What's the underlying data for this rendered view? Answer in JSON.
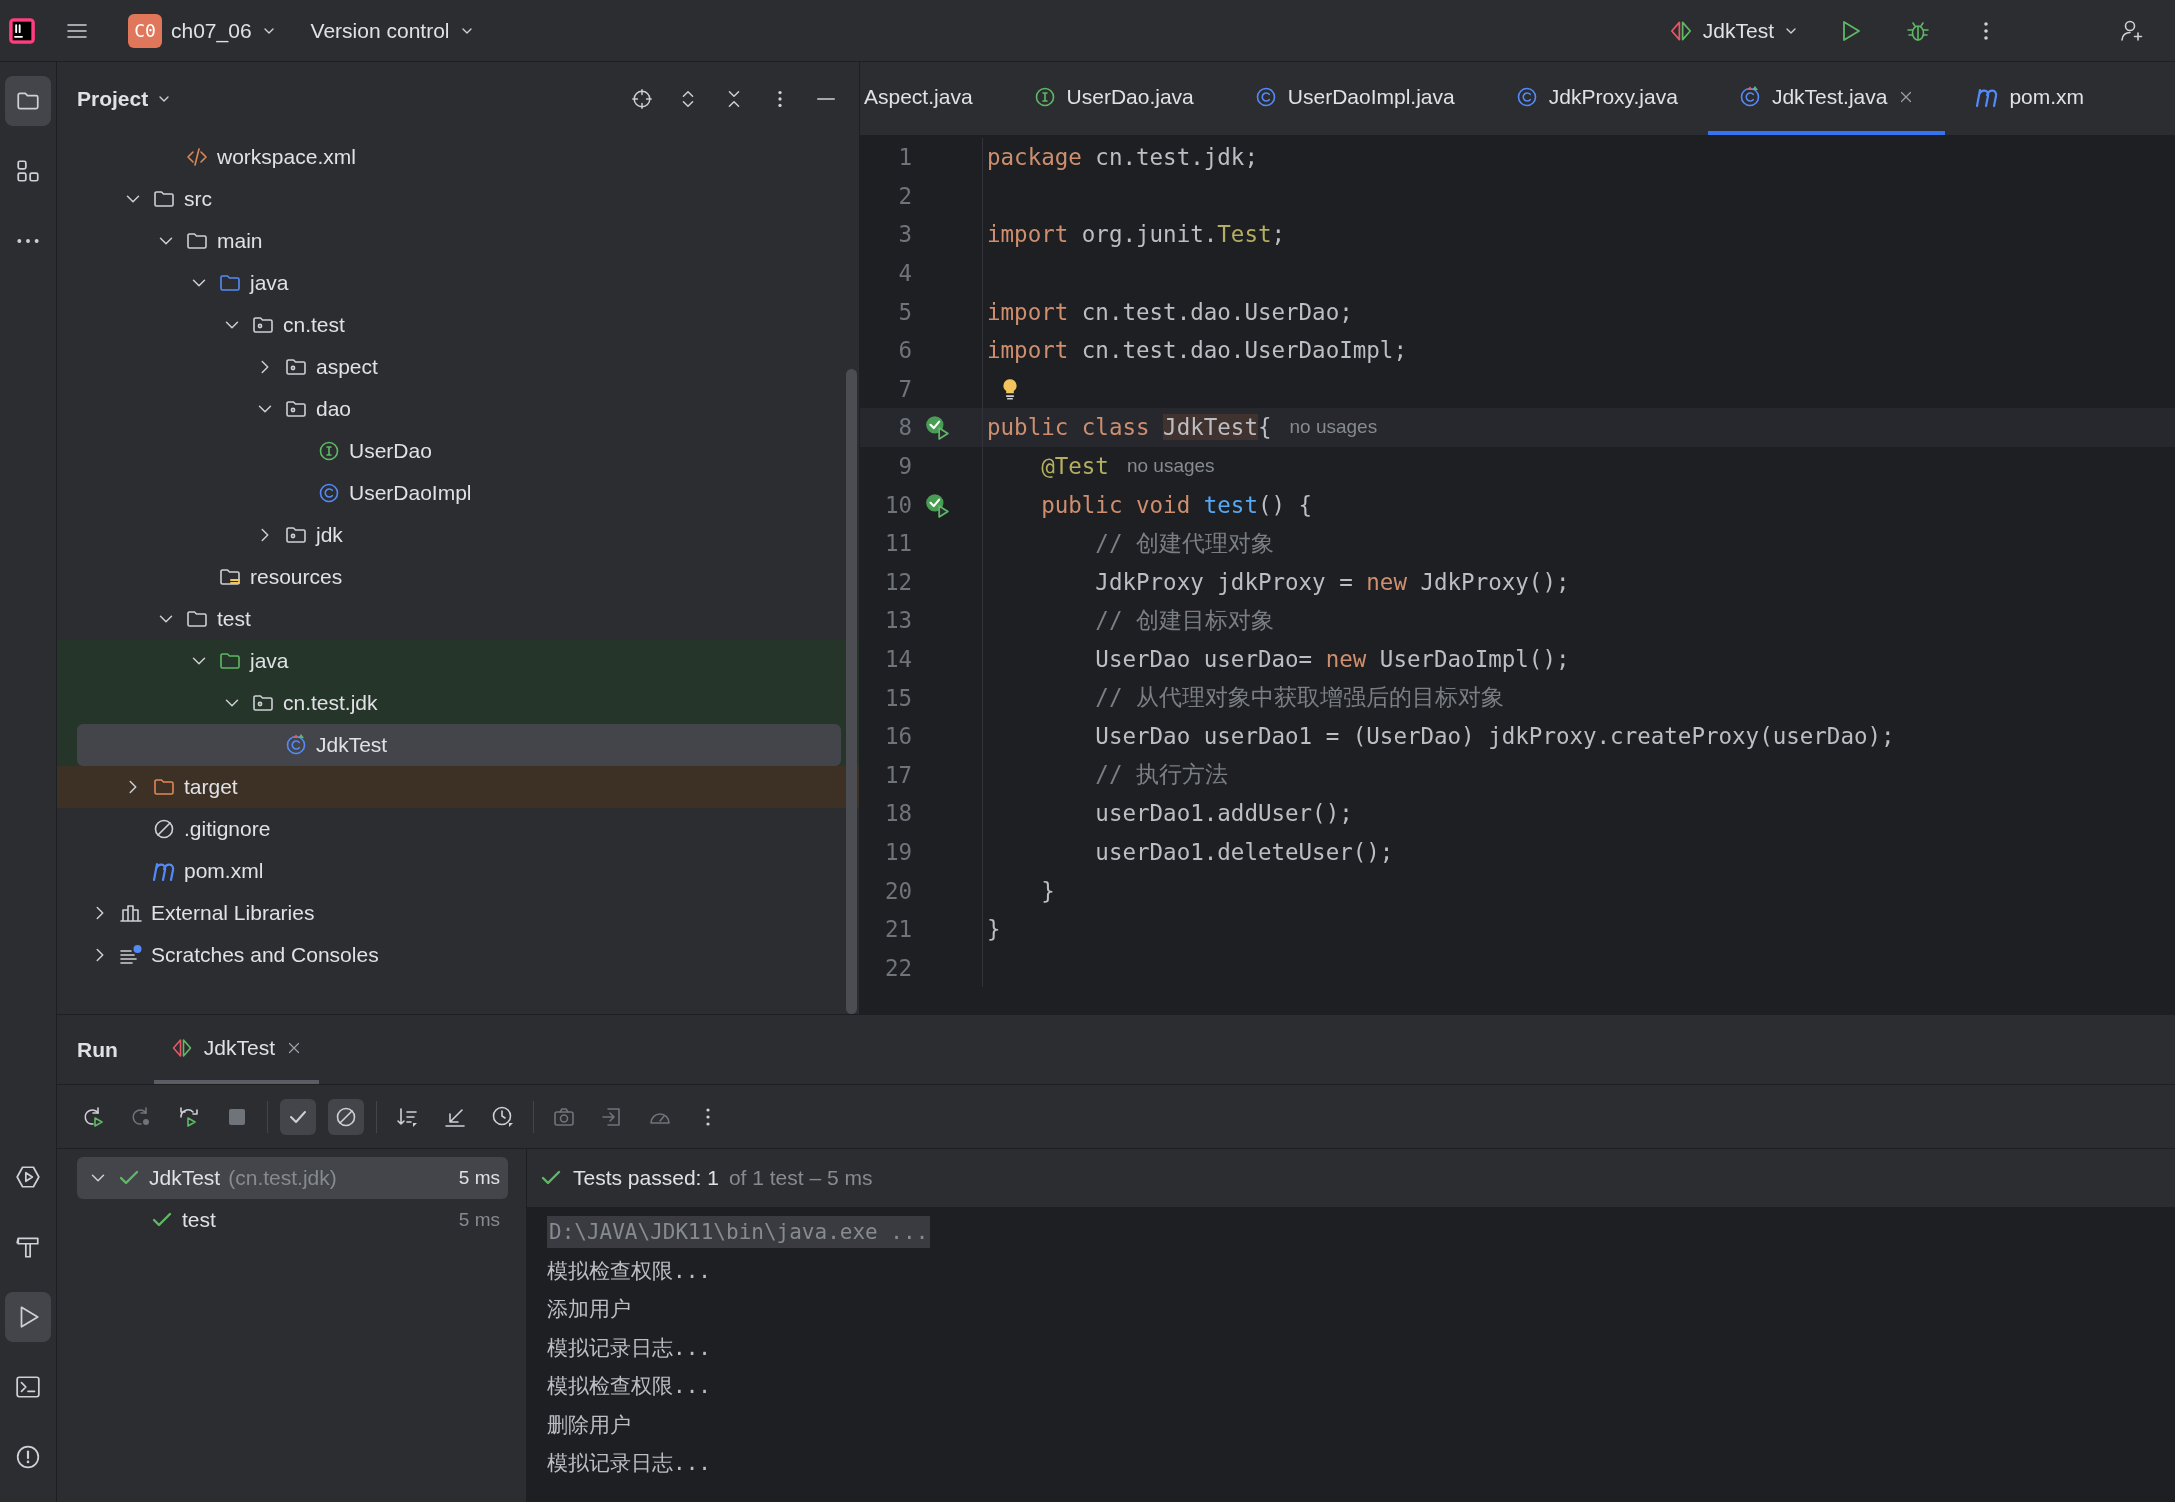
{
  "top_bar": {
    "project_badge": "C0",
    "project_name": "ch07_06",
    "vcs_menu": "Version control",
    "run_config": "JdkTest"
  },
  "left_toolbar": {
    "top": [
      {
        "kind": "project",
        "selected": true
      },
      {
        "kind": "structure",
        "selected": false
      },
      {
        "kind": "more",
        "selected": false
      }
    ],
    "bottom": [
      {
        "kind": "services",
        "selected": false
      },
      {
        "kind": "build",
        "selected": false
      },
      {
        "kind": "run",
        "selected": true
      },
      {
        "kind": "terminal",
        "selected": false
      },
      {
        "kind": "problems",
        "selected": false
      }
    ]
  },
  "project_panel": {
    "title": "Project",
    "tree": [
      {
        "kind": "clipped",
        "children": [
          {
            "label": "workspace.xml",
            "kind": "xml",
            "selected": false
          }
        ]
      },
      {
        "label": "src",
        "kind": "folder",
        "expanded": true,
        "selected": false,
        "children": [
          {
            "label": "main",
            "kind": "folder",
            "expanded": true,
            "selected": false,
            "children": [
              {
                "label": "java",
                "kind": "source-folder",
                "expanded": true,
                "selected": false,
                "children": [
                  {
                    "label": "cn.test",
                    "kind": "package",
                    "expanded": true,
                    "selected": false,
                    "children": [
                      {
                        "label": "aspect",
                        "kind": "package",
                        "expanded": false,
                        "selected": false
                      },
                      {
                        "label": "dao",
                        "kind": "package",
                        "expanded": true,
                        "selected": false,
                        "children": [
                          {
                            "label": "UserDao",
                            "kind": "interface",
                            "selected": false
                          },
                          {
                            "label": "UserDaoImpl",
                            "kind": "class",
                            "selected": false
                          }
                        ]
                      },
                      {
                        "label": "jdk",
                        "kind": "package",
                        "expanded": false,
                        "selected": false
                      }
                    ]
                  }
                ]
              },
              {
                "label": "resources",
                "kind": "resources",
                "selected": false
              }
            ]
          },
          {
            "label": "test",
            "kind": "folder",
            "expanded": true,
            "selected": false,
            "children": [
              {
                "label": "java",
                "kind": "test-folder",
                "expanded": true,
                "selected": false,
                "test_scope": true,
                "children": [
                  {
                    "label": "cn.test.jdk",
                    "kind": "package",
                    "expanded": true,
                    "selected": false,
                    "test_scope": true,
                    "children": [
                      {
                        "label": "JdkTest",
                        "kind": "test-class",
                        "selected": true,
                        "test_scope": true
                      }
                    ]
                  }
                ]
              }
            ]
          }
        ]
      },
      {
        "label": "target",
        "kind": "excluded-folder",
        "expanded": false,
        "selected": false,
        "excluded": true
      },
      {
        "label": ".gitignore",
        "kind": "ignore",
        "selected": false
      },
      {
        "label": "pom.xml",
        "kind": "maven",
        "selected": false
      }
    ],
    "roots": [
      {
        "label": "External Libraries",
        "kind": "libraries",
        "expanded": false,
        "selected": false
      },
      {
        "label": "Scratches and Consoles",
        "kind": "scratches",
        "expanded": false,
        "selected": false
      }
    ]
  },
  "editor": {
    "tabs": [
      {
        "label": "Aspect.java",
        "selected": false,
        "closable": false
      },
      {
        "label": "UserDao.java",
        "kind": "interface",
        "selected": false,
        "closable": false
      },
      {
        "label": "UserDaoImpl.java",
        "kind": "class",
        "selected": false,
        "closable": false
      },
      {
        "label": "JdkProxy.java",
        "kind": "class",
        "selected": false,
        "closable": false
      },
      {
        "label": "JdkTest.java",
        "kind": "test-class",
        "selected": true,
        "closable": true
      },
      {
        "label": "pom.xm",
        "kind": "maven",
        "selected": false,
        "closable": false
      }
    ],
    "lines": [
      {
        "number": "1",
        "tokens": [
          {
            "text": "package",
            "kind": "keyword"
          },
          {
            "text": " cn.test.jdk;",
            "kind": "plain"
          }
        ]
      },
      {
        "number": "2"
      },
      {
        "number": "3",
        "tokens": [
          {
            "text": "import",
            "kind": "keyword"
          },
          {
            "text": " org.junit.",
            "kind": "plain"
          },
          {
            "text": "Test",
            "kind": "annotation"
          },
          {
            "text": ";",
            "kind": "plain"
          }
        ]
      },
      {
        "number": "4"
      },
      {
        "number": "5",
        "tokens": [
          {
            "text": "import",
            "kind": "keyword"
          },
          {
            "text": " cn.test.dao.UserDao;",
            "kind": "plain"
          }
        ]
      },
      {
        "number": "6",
        "tokens": [
          {
            "text": "import",
            "kind": "keyword"
          },
          {
            "text": " cn.test.dao.UserDaoImpl;",
            "kind": "plain"
          }
        ]
      },
      {
        "number": "7",
        "lightbulb": true
      },
      {
        "number": "8",
        "current": true,
        "run_gutter": true,
        "tokens": [
          {
            "text": "public class ",
            "kind": "keyword"
          },
          {
            "text": "JdkTest",
            "kind": "usage"
          },
          {
            "text": "{",
            "kind": "plain"
          }
        ],
        "hint": "no usages"
      },
      {
        "number": "9",
        "tokens": [
          {
            "text": "    @Test",
            "kind": "annotation"
          }
        ],
        "hint": "no usages"
      },
      {
        "number": "10",
        "run_gutter": true,
        "tokens": [
          {
            "text": "    public void ",
            "kind": "keyword"
          },
          {
            "text": "test",
            "kind": "method"
          },
          {
            "text": "() {",
            "kind": "plain"
          }
        ]
      },
      {
        "number": "11",
        "tokens": [
          {
            "text": "        // 创建代理对象",
            "kind": "comment"
          }
        ]
      },
      {
        "number": "12",
        "tokens": [
          {
            "text": "        JdkProxy jdkProxy = ",
            "kind": "plain"
          },
          {
            "text": "new",
            "kind": "keyword"
          },
          {
            "text": " JdkProxy();",
            "kind": "plain"
          }
        ]
      },
      {
        "number": "13",
        "tokens": [
          {
            "text": "        // 创建目标对象",
            "kind": "comment"
          }
        ]
      },
      {
        "number": "14",
        "tokens": [
          {
            "text": "        UserDao userDao= ",
            "kind": "plain"
          },
          {
            "text": "new",
            "kind": "keyword"
          },
          {
            "text": " UserDaoImpl();",
            "kind": "plain"
          }
        ]
      },
      {
        "number": "15",
        "tokens": [
          {
            "text": "        // 从代理对象中获取增强后的目标对象",
            "kind": "comment"
          }
        ]
      },
      {
        "number": "16",
        "tokens": [
          {
            "text": "        UserDao userDao1 = (UserDao) jdkProxy.createProxy(userDao);",
            "kind": "plain"
          }
        ]
      },
      {
        "number": "17",
        "tokens": [
          {
            "text": "        // 执行方法",
            "kind": "comment"
          }
        ]
      },
      {
        "number": "18",
        "tokens": [
          {
            "text": "        userDao1.addUser();",
            "kind": "plain"
          }
        ]
      },
      {
        "number": "19",
        "tokens": [
          {
            "text": "        userDao1.deleteUser();",
            "kind": "plain"
          }
        ]
      },
      {
        "number": "20",
        "tokens": [
          {
            "text": "    }",
            "kind": "plain"
          }
        ]
      },
      {
        "number": "21",
        "tokens": [
          {
            "text": "}",
            "kind": "plain"
          }
        ]
      },
      {
        "number": "22"
      }
    ]
  },
  "run_panel": {
    "title": "Run",
    "tabs": [
      {
        "label": "JdkTest",
        "selected": true,
        "closable": true
      }
    ],
    "toolbar_groups": [
      {
        "buttons": [
          {
            "kind": "rerun",
            "disabled": false,
            "on": false
          },
          {
            "kind": "rerun-failed",
            "disabled": true,
            "on": false
          },
          {
            "kind": "auto-test",
            "disabled": false,
            "on": false
          },
          {
            "kind": "stop",
            "disabled": true,
            "on": false
          }
        ]
      },
      {
        "buttons": [
          {
            "kind": "show-passed",
            "disabled": false,
            "on": true
          },
          {
            "kind": "show-ignored",
            "disabled": false,
            "on": true
          }
        ]
      },
      {
        "buttons": [
          {
            "kind": "sort",
            "disabled": false,
            "on": false
          },
          {
            "kind": "import",
            "disabled": false,
            "on": false
          },
          {
            "kind": "history",
            "disabled": false,
            "on": false
          }
        ]
      },
      {
        "buttons": [
          {
            "kind": "screenshot",
            "disabled": true,
            "on": false
          },
          {
            "kind": "export",
            "disabled": true,
            "on": false
          },
          {
            "kind": "coverage",
            "disabled": true,
            "on": false
          },
          {
            "kind": "more",
            "disabled": false,
            "on": false
          }
        ]
      }
    ],
    "tests": [
      {
        "label": "JdkTest",
        "detail": "(cn.test.jdk)",
        "time": "5 ms",
        "passed": true,
        "expanded": true,
        "selected": true,
        "children": [
          {
            "label": "test",
            "time": "5 ms",
            "passed": true,
            "selected": false
          }
        ]
      }
    ],
    "summary": {
      "passed": true,
      "label": "Tests passed: 1",
      "detail": "of 1 test – 5 ms"
    },
    "output": [
      {
        "text": "D:\\JAVA\\JDK11\\bin\\java.exe ...",
        "kind": "command"
      },
      {
        "text": "模拟检查权限...",
        "kind": "stdout"
      },
      {
        "text": "添加用户",
        "kind": "stdout"
      },
      {
        "text": "模拟记录日志...",
        "kind": "stdout"
      },
      {
        "text": "模拟检查权限...",
        "kind": "stdout"
      },
      {
        "text": "删除用户",
        "kind": "stdout"
      },
      {
        "text": "模拟记录日志...",
        "kind": "stdout"
      }
    ]
  }
}
